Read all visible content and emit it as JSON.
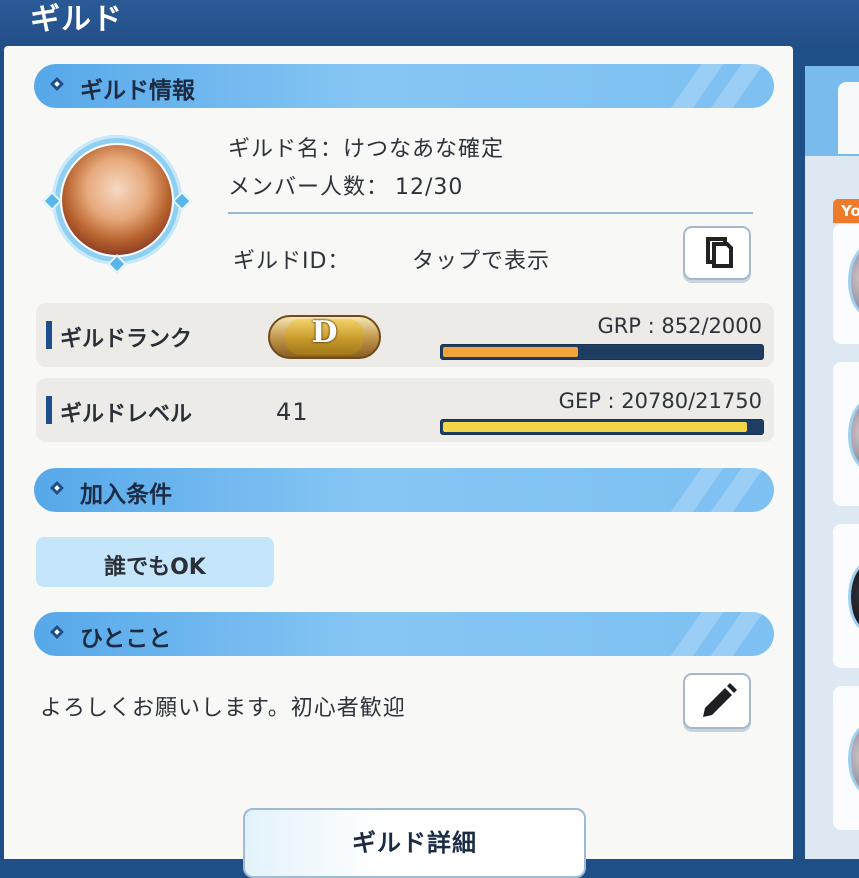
{
  "header": {
    "title": "ギルド"
  },
  "sections": {
    "info": "ギルド情報",
    "conditions": "加入条件",
    "message": "ひとこと"
  },
  "guild": {
    "name_label": "ギルド名：",
    "name_value": "けつなあな確定",
    "members_label": "メンバー人数：",
    "members_value": "12/30",
    "id_label": "ギルドID：",
    "id_value": "タップで表示",
    "rank_label": "ギルドランク",
    "rank_letter": "D",
    "grp_text": "GRP : 852/2000",
    "grp_current": 852,
    "grp_max": 2000,
    "level_label": "ギルドレベル",
    "level_value": "41",
    "gep_text": "GEP : 20780/21750",
    "gep_current": 20780,
    "gep_max": 21750,
    "condition": "誰でもOK",
    "message": "よろしくお願いします。初心者歓迎"
  },
  "buttons": {
    "detail": "ギルド詳細",
    "copy_icon": "copy-icon",
    "edit_icon": "pencil-icon"
  },
  "right_panel": {
    "badge": "Yo"
  },
  "colors": {
    "accent": "#1d4f8c",
    "section": "#6fb8ef",
    "grp_fill": "#f0a53a",
    "gep_fill": "#f3d548"
  }
}
